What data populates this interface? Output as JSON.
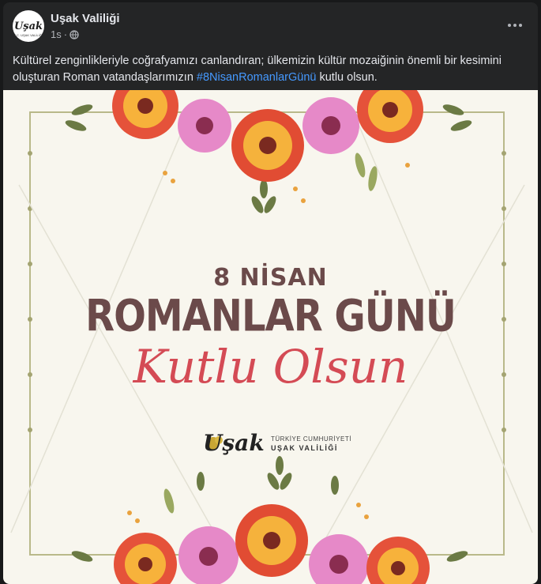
{
  "page": {
    "name": "Uşak Valiliği",
    "time": "1s",
    "time_separator": "·",
    "avatar_text": "Uşak",
    "avatar_sub": "T.C. UŞAK VALİLİĞİ"
  },
  "post": {
    "text_before": "Kültürel zenginlikleriyle coğrafyamızı canlandıran; ülkemizin kültür mozaiğinin önemli bir kesimini oluşturan Roman vatandaşlarımızın ",
    "hashtag": "#8NisanRomanlarGünü",
    "text_after": " kutlu olsun."
  },
  "image": {
    "line1": "8 NİSAN",
    "line2": "ROMANLAR GÜNÜ",
    "script": "Kutlu Olsun",
    "brand_logo": "Uşak",
    "brand_line1": "TÜRKİYE CUMHURİYETİ",
    "brand_line2": "UŞAK VALİLİĞİ"
  },
  "icons": {
    "privacy": "globe-icon",
    "menu": "more-options-icon"
  },
  "colors": {
    "background": "#242526",
    "text": "#e4e6eb",
    "secondary_text": "#b0b3b8",
    "hashtag": "#4599ff",
    "card": "#f8f6ee",
    "title": "#6b4a4a",
    "script": "#d44b55"
  }
}
